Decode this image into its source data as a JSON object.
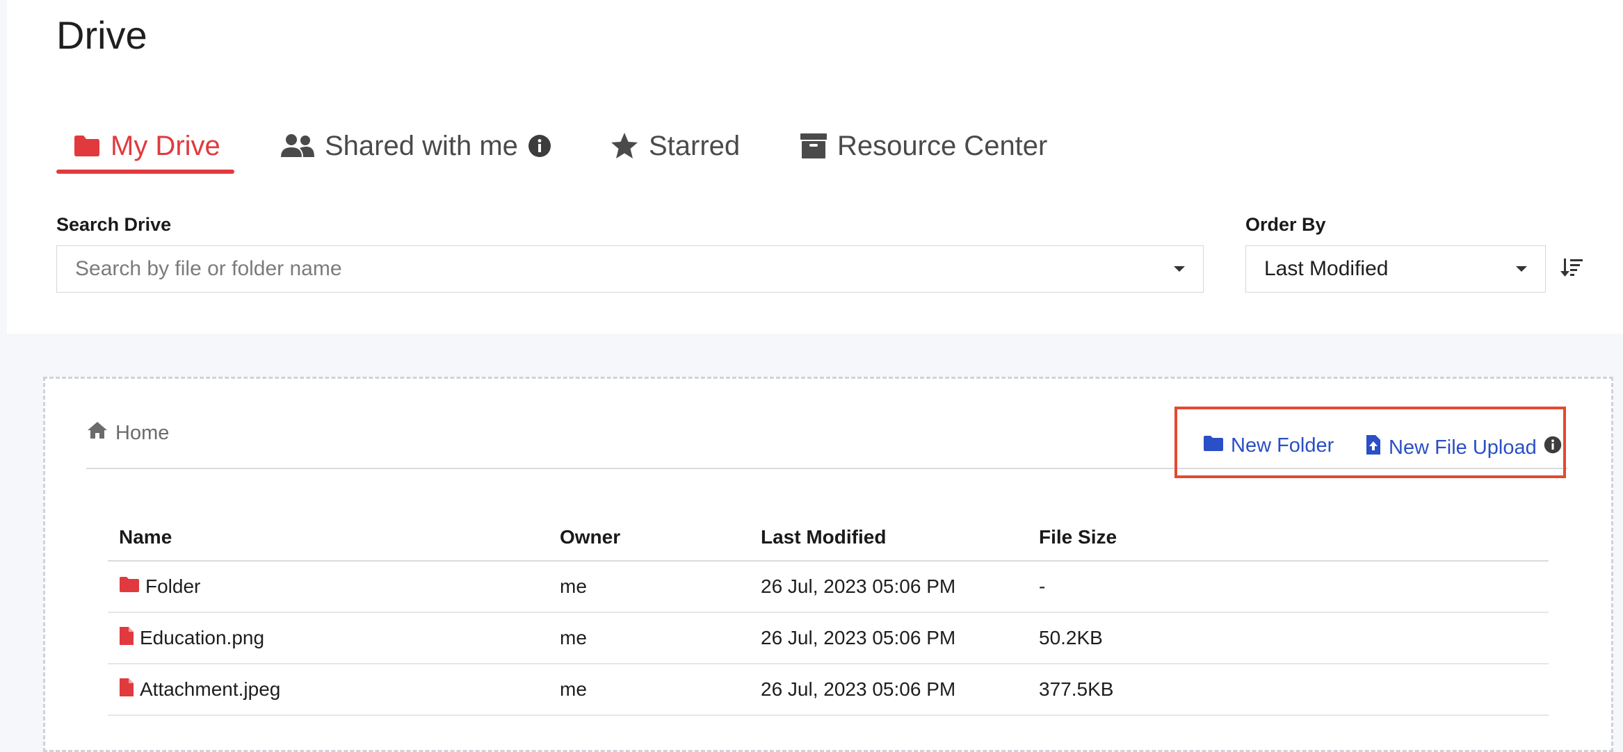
{
  "page": {
    "title": "Drive"
  },
  "tabs": [
    {
      "label": "My Drive",
      "icon": "folder-icon",
      "active": true
    },
    {
      "label": "Shared with me",
      "icon": "users-icon",
      "active": false
    },
    {
      "label": "Starred",
      "icon": "star-icon",
      "active": false
    },
    {
      "label": "Resource Center",
      "icon": "archive-icon",
      "active": false
    }
  ],
  "search": {
    "label": "Search Drive",
    "placeholder": "Search by file or folder name"
  },
  "order": {
    "label": "Order By",
    "value": "Last Modified"
  },
  "breadcrumb": {
    "home_label": "Home"
  },
  "actions": {
    "new_folder": "New Folder",
    "new_file_upload": "New File Upload"
  },
  "table": {
    "columns": [
      "Name",
      "Owner",
      "Last Modified",
      "File Size"
    ],
    "rows": [
      {
        "name": "Folder",
        "type": "folder",
        "owner": "me",
        "modified": "26 Jul, 2023 05:06 PM",
        "size": "-"
      },
      {
        "name": "Education.png",
        "type": "file",
        "owner": "me",
        "modified": "26 Jul, 2023 05:06 PM",
        "size": "50.2KB"
      },
      {
        "name": "Attachment.jpeg",
        "type": "file",
        "owner": "me",
        "modified": "26 Jul, 2023 05:06 PM",
        "size": "377.5KB"
      }
    ]
  },
  "colors": {
    "accent": "#e03a3e",
    "link": "#2a4fc6",
    "highlight": "#e34a2f"
  }
}
